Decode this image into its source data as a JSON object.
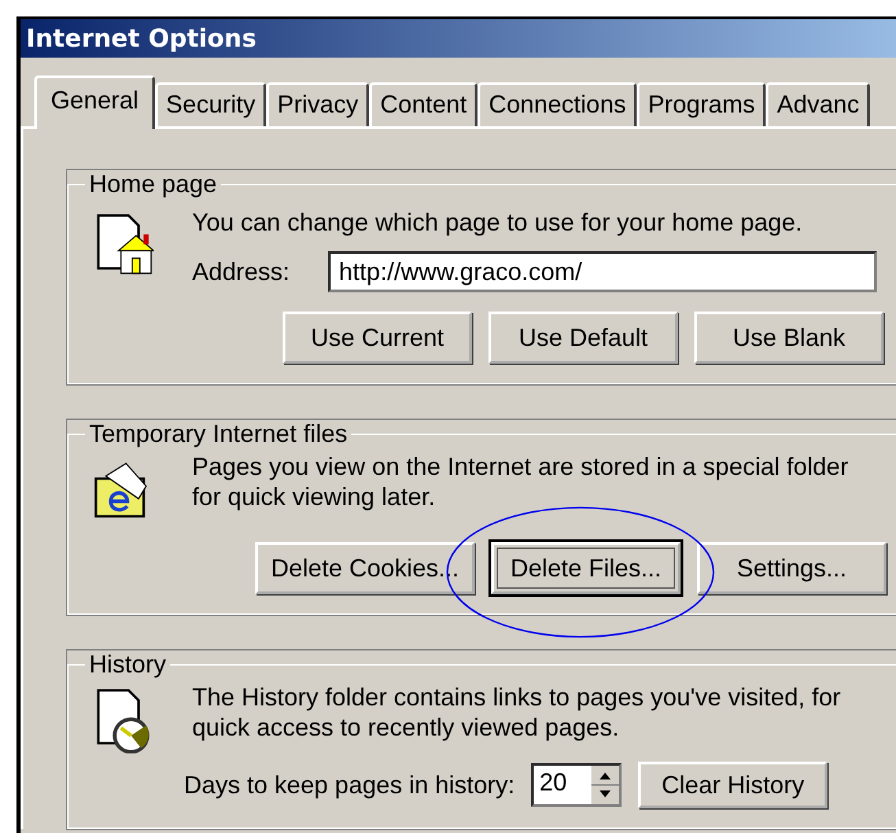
{
  "window": {
    "title": "Internet Options"
  },
  "tabs": [
    {
      "label": "General",
      "selected": true
    },
    {
      "label": "Security",
      "selected": false
    },
    {
      "label": "Privacy",
      "selected": false
    },
    {
      "label": "Content",
      "selected": false
    },
    {
      "label": "Connections",
      "selected": false
    },
    {
      "label": "Programs",
      "selected": false
    },
    {
      "label": "Advanc",
      "selected": false
    }
  ],
  "home_page": {
    "title": "Home page",
    "description": "You can change which page to use for your home page.",
    "address_label": "Address:",
    "address_value": "http://www.graco.com/",
    "buttons": [
      "Use Current",
      "Use Default",
      "Use Blank"
    ]
  },
  "temporary_files": {
    "title": "Temporary Internet files",
    "description": "Pages you view on the Internet are stored in a special folder for quick viewing later.",
    "buttons": [
      {
        "label": "Delete Cookies...",
        "focused": false
      },
      {
        "label": "Delete Files...",
        "focused": true
      },
      {
        "label": "Settings...",
        "focused": false
      }
    ]
  },
  "history": {
    "title": "History",
    "description": "The History folder contains links to pages you've visited, for quick access to recently viewed pages.",
    "days_label": "Days to keep pages in history:",
    "days_value": "20",
    "clear_button": "Clear History"
  }
}
